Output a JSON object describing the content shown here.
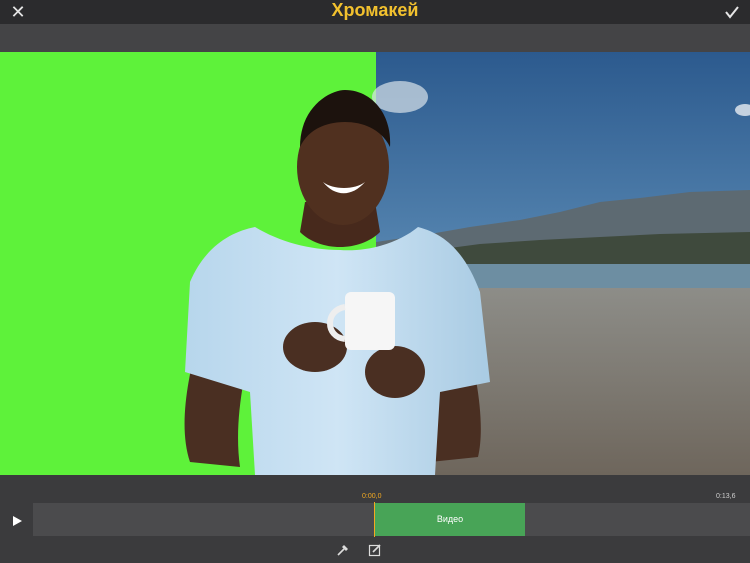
{
  "header": {
    "title": "Хромакей",
    "close_icon": "close-icon",
    "done_icon": "checkmark-icon"
  },
  "preview": {
    "left_background_color": "#5ef23a",
    "subject": "man in light blue t-shirt holding white mug",
    "right_background": "beach with mountains and blue sky"
  },
  "timeline": {
    "play_icon": "play-icon",
    "current_time": "0:00,0",
    "end_time": "0:13,6",
    "clip_label": "Видео",
    "clip_color": "#48a457",
    "playhead_color": "#f2a922"
  },
  "tools": {
    "eyedropper_icon": "eyedropper-icon",
    "edit_icon": "edit-icon"
  }
}
